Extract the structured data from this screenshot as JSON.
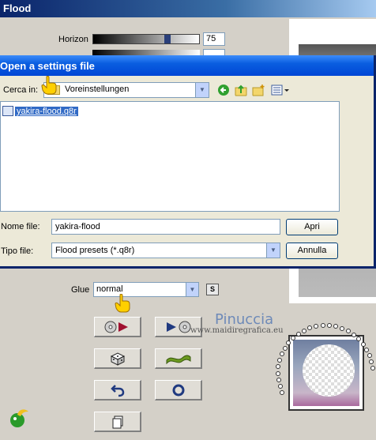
{
  "flood": {
    "title": "Flood",
    "horizon_label": "Horizon",
    "horizon_value": "75",
    "horizon_level": 0.75,
    "glue_label": "Glue",
    "glue_value": "normal",
    "s_button": "S",
    "brand_name": "Pinuccia",
    "brand_url": "www.maidiregrafica.eu"
  },
  "dialog": {
    "title": "Open a settings file",
    "look_in_label": "Cerca in:",
    "look_in_value": "Voreinstellungen",
    "file_item": "yakira-flood.q8r",
    "file_name_label": "Nome file:",
    "file_name_value": "yakira-flood",
    "file_type_label": "Tipo file:",
    "file_type_value": "Flood presets (*.q8r)",
    "open_button": "Apri",
    "cancel_button": "Annulla"
  },
  "colors": {
    "dialog_title": "#0a5ee0",
    "selection": "#316ac5",
    "window_bg": "#d4d0c8"
  }
}
